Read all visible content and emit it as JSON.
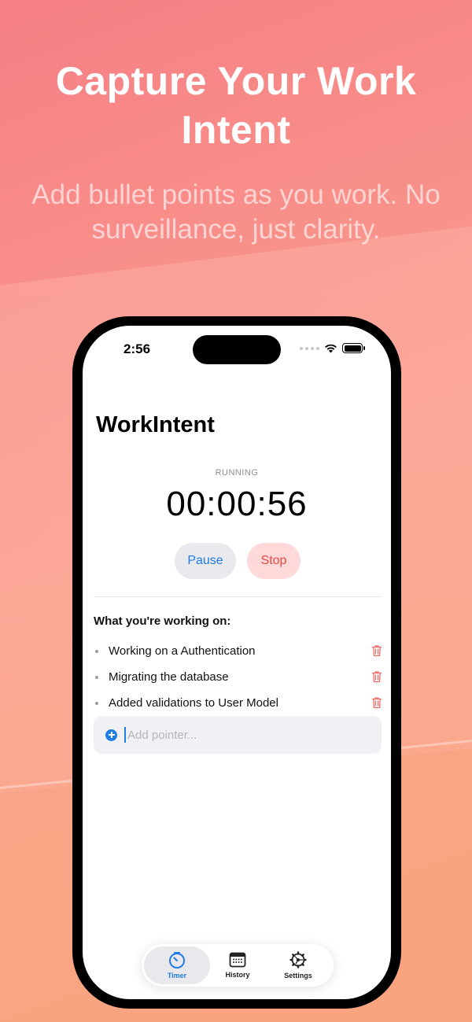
{
  "hero": {
    "title": "Capture Your Work Intent",
    "subtitle": "Add bullet points as you work. No surveillance, just clarity."
  },
  "status_bar": {
    "time": "2:56"
  },
  "app": {
    "title": "WorkIntent",
    "timer_state": "RUNNING",
    "timer_value": "00:00:56",
    "pause_label": "Pause",
    "stop_label": "Stop",
    "section_title": "What you're working on:",
    "pointers": [
      {
        "text": "Working on a Authentication"
      },
      {
        "text": "Migrating the database"
      },
      {
        "text": "Added validations to User Model"
      }
    ],
    "add_placeholder": "Add pointer..."
  },
  "tabbar": {
    "tabs": [
      {
        "label": "Timer",
        "icon": "timer-icon",
        "selected": true
      },
      {
        "label": "History",
        "icon": "calendar-icon",
        "selected": false
      },
      {
        "label": "Settings",
        "icon": "gear-icon",
        "selected": false
      }
    ]
  },
  "colors": {
    "accent": "#1f7ee6",
    "destructive": "#e5483f",
    "background_top": "#f67f86",
    "background_bottom": "#f9a47c"
  }
}
